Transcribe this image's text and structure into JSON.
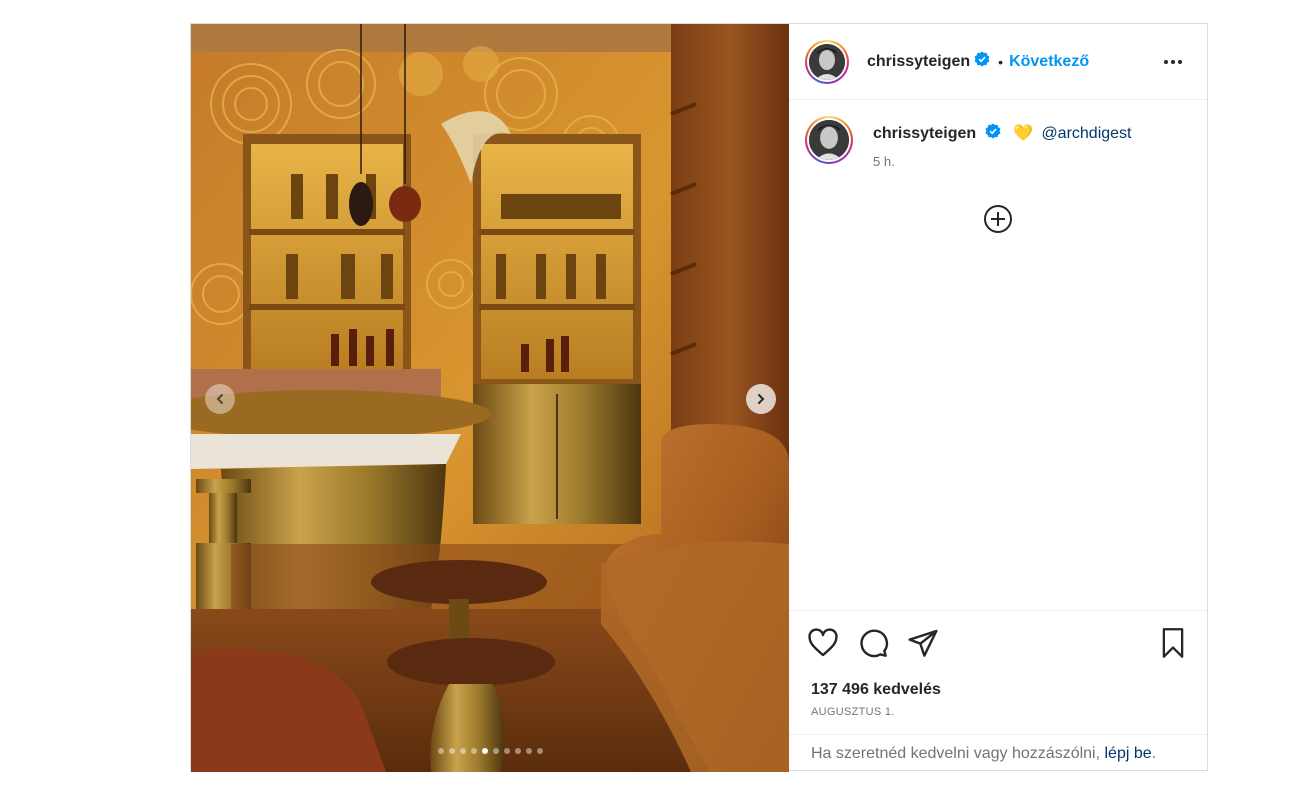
{
  "post": {
    "username": "chrissyteigen",
    "separator": "•",
    "follow_label": "Következő",
    "caption_mention": "@archdigest",
    "caption_emoji": "💛",
    "time_ago": "5 h.",
    "likes": "137 496 kedvelés",
    "date": "AUGUSZTUS 1.",
    "login_prompt": "Ha szeretnéd kedvelni vagy hozzászólni, ",
    "login_link": "lépj be",
    "login_suffix": ".",
    "carousel": {
      "total": 10,
      "active": 4
    }
  },
  "colors": {
    "follow": "#0095f6",
    "link": "#00376b",
    "verified": "#0095f6"
  },
  "icons": {
    "more": "more-icon",
    "like": "heart-outline-icon",
    "comment": "comment-icon",
    "share": "send-icon",
    "save": "bookmark-icon",
    "add": "plus-circle-icon"
  }
}
